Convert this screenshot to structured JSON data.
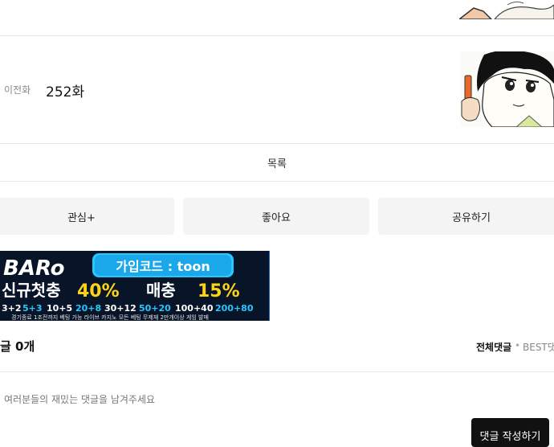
{
  "episode_nav": {
    "prev_label": "이전화",
    "prev_episode": "252화"
  },
  "list_label": "목록",
  "actions": {
    "interest": "관심+",
    "like": "좋아요",
    "share": "공유하기"
  },
  "banner": {
    "brand": "BARo",
    "code_label": "가입코드 : toon",
    "headline_a": "신규첫충",
    "headline_pct_a": "40%",
    "headline_b": "매충",
    "headline_pct_b": "15%",
    "bonus_tiers": [
      "3+2",
      "5+3",
      "10+5",
      "20+8",
      "30+12",
      "50+20",
      "100+40",
      "200+80"
    ],
    "fine_print": "경기종료 1조전까지 베팅 가능 라이브 카지노 모든 베팅 무제재 2만개이상 게임 발매"
  },
  "comments": {
    "title": "글 0개",
    "sort_all": "전체댓글",
    "sort_sep": "•",
    "sort_best": "BEST댓",
    "placeholder": "여러분들의 재밌는 댓글을 남겨주세요",
    "write_button": "댓글 작성하기"
  },
  "colors": {
    "button_bg": "#f4f4f4",
    "write_bg": "#111111",
    "banner_bg": "#0a1830",
    "banner_accent_yellow": "#ffd21a",
    "banner_accent_cyan": "#25c8ff"
  }
}
